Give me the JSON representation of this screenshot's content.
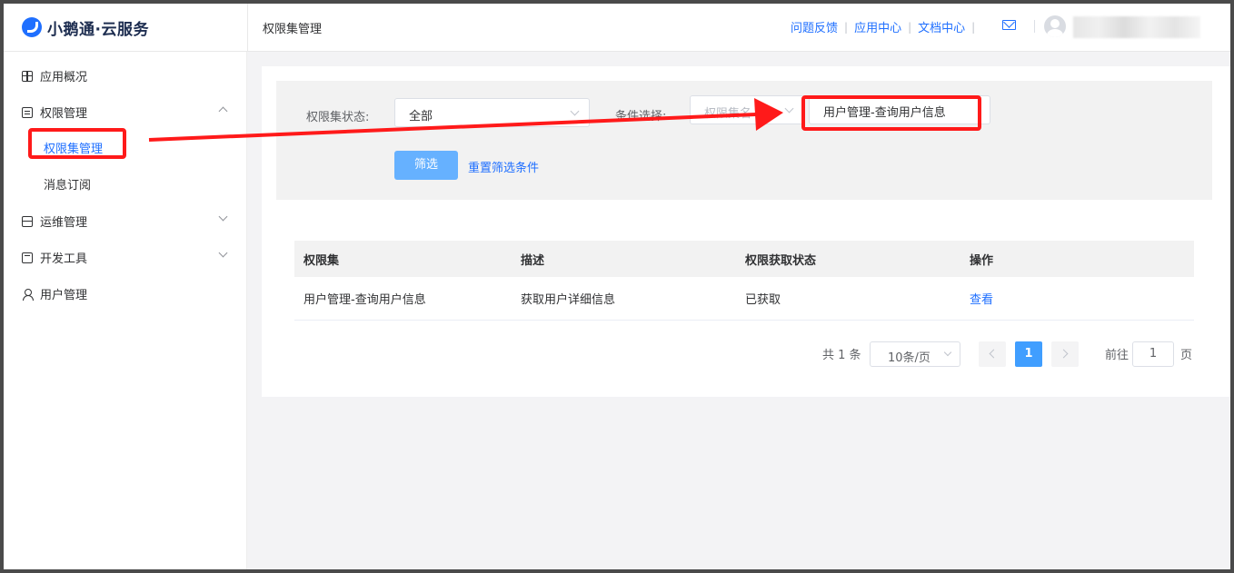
{
  "app": {
    "logo_text": "小鹅通·云服务",
    "page_title": "权限集管理",
    "top_links": [
      "问题反馈",
      "应用中心",
      "文档中心"
    ],
    "separator": "|"
  },
  "sidebar": {
    "items": [
      {
        "label": "应用概况",
        "icon": "grid-icon"
      },
      {
        "label": "权限管理",
        "icon": "document-icon",
        "expanded": true,
        "children": [
          {
            "label": "权限集管理",
            "active": true
          },
          {
            "label": "消息订阅",
            "active": false
          }
        ]
      },
      {
        "label": "运维管理",
        "icon": "server-icon",
        "expanded": false
      },
      {
        "label": "开发工具",
        "icon": "code-icon",
        "expanded": false
      },
      {
        "label": "用户管理",
        "icon": "user-icon"
      }
    ]
  },
  "filter": {
    "status_label": "权限集状态:",
    "status_value": "全部",
    "condition_label": "条件选择:",
    "condition_type": "权限集名",
    "condition_value": "用户管理-查询用户信息",
    "submit_label": "筛选",
    "reset_label": "重置筛选条件"
  },
  "table": {
    "headers": [
      "权限集",
      "描述",
      "权限获取状态",
      "操作"
    ],
    "rows": [
      {
        "name": "用户管理-查询用户信息",
        "desc": "获取用户详细信息",
        "status": "已获取",
        "action": "查看"
      }
    ]
  },
  "pagination": {
    "total_text": "共 1 条",
    "page_size": "10条/页",
    "current_page": "1",
    "goto_label": "前往",
    "goto_value": "1",
    "page_suffix": "页"
  },
  "annotation": {
    "color": "#ff1a1a"
  }
}
